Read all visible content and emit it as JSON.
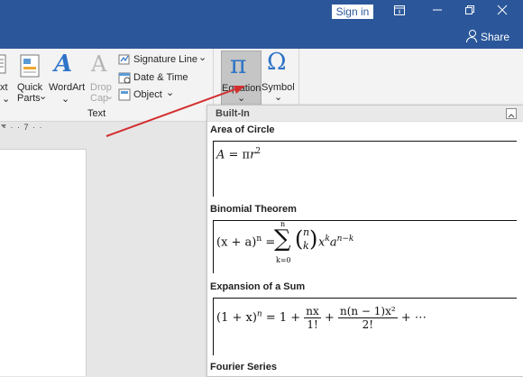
{
  "titlebar": {
    "sign_in": "Sign in"
  },
  "ribbon": {
    "share": "Share",
    "text_box_partial": "xt",
    "quick_parts_line1": "Quick",
    "quick_parts_line2": "Parts",
    "wordart": "WordArt",
    "drop_cap_line1": "Drop",
    "drop_cap_line2": "Cap",
    "signature_line": "Signature Line",
    "date_time": "Date & Time",
    "object": "Object",
    "group_text": "Text",
    "equation": "Equation",
    "symbol": "Symbol",
    "equation_glyph": "π",
    "symbol_glyph": "Ω",
    "wordart_glyph": "A",
    "dropcap_glyph": "A"
  },
  "ruler": {
    "marks": "· · · 7 · ·"
  },
  "gallery": {
    "header": "Built-In",
    "sections": [
      {
        "title": "Area of Circle"
      },
      {
        "title": "Binomial Theorem"
      },
      {
        "title": "Expansion of a Sum"
      },
      {
        "title": "Fourier Series"
      }
    ],
    "eq1": {
      "lhs": "A",
      "eq": " = π",
      "r": "r",
      "exp": "2"
    },
    "eq2": {
      "lhs": "(x + a)",
      "lhs_exp": "n",
      "eq": " = ",
      "sum_top": "n",
      "sigma": "∑",
      "sum_bottom": "k=0",
      "binom_top": "n",
      "binom_bottom": "k",
      "x": "x",
      "x_exp": "k",
      "a": "a",
      "a_exp": "n−k"
    },
    "eq3": {
      "lhs": "(1 + x)",
      "lhs_exp": "n",
      "eq": " = 1 + ",
      "f1_num": "nx",
      "f1_den": "1!",
      "plus": " + ",
      "f2_num": "n(n − 1)x²",
      "f2_den": "2!",
      "tail": " + ⋯"
    }
  },
  "colors": {
    "title_blue": "#2b579a",
    "arrow_red": "#d32f2f"
  }
}
